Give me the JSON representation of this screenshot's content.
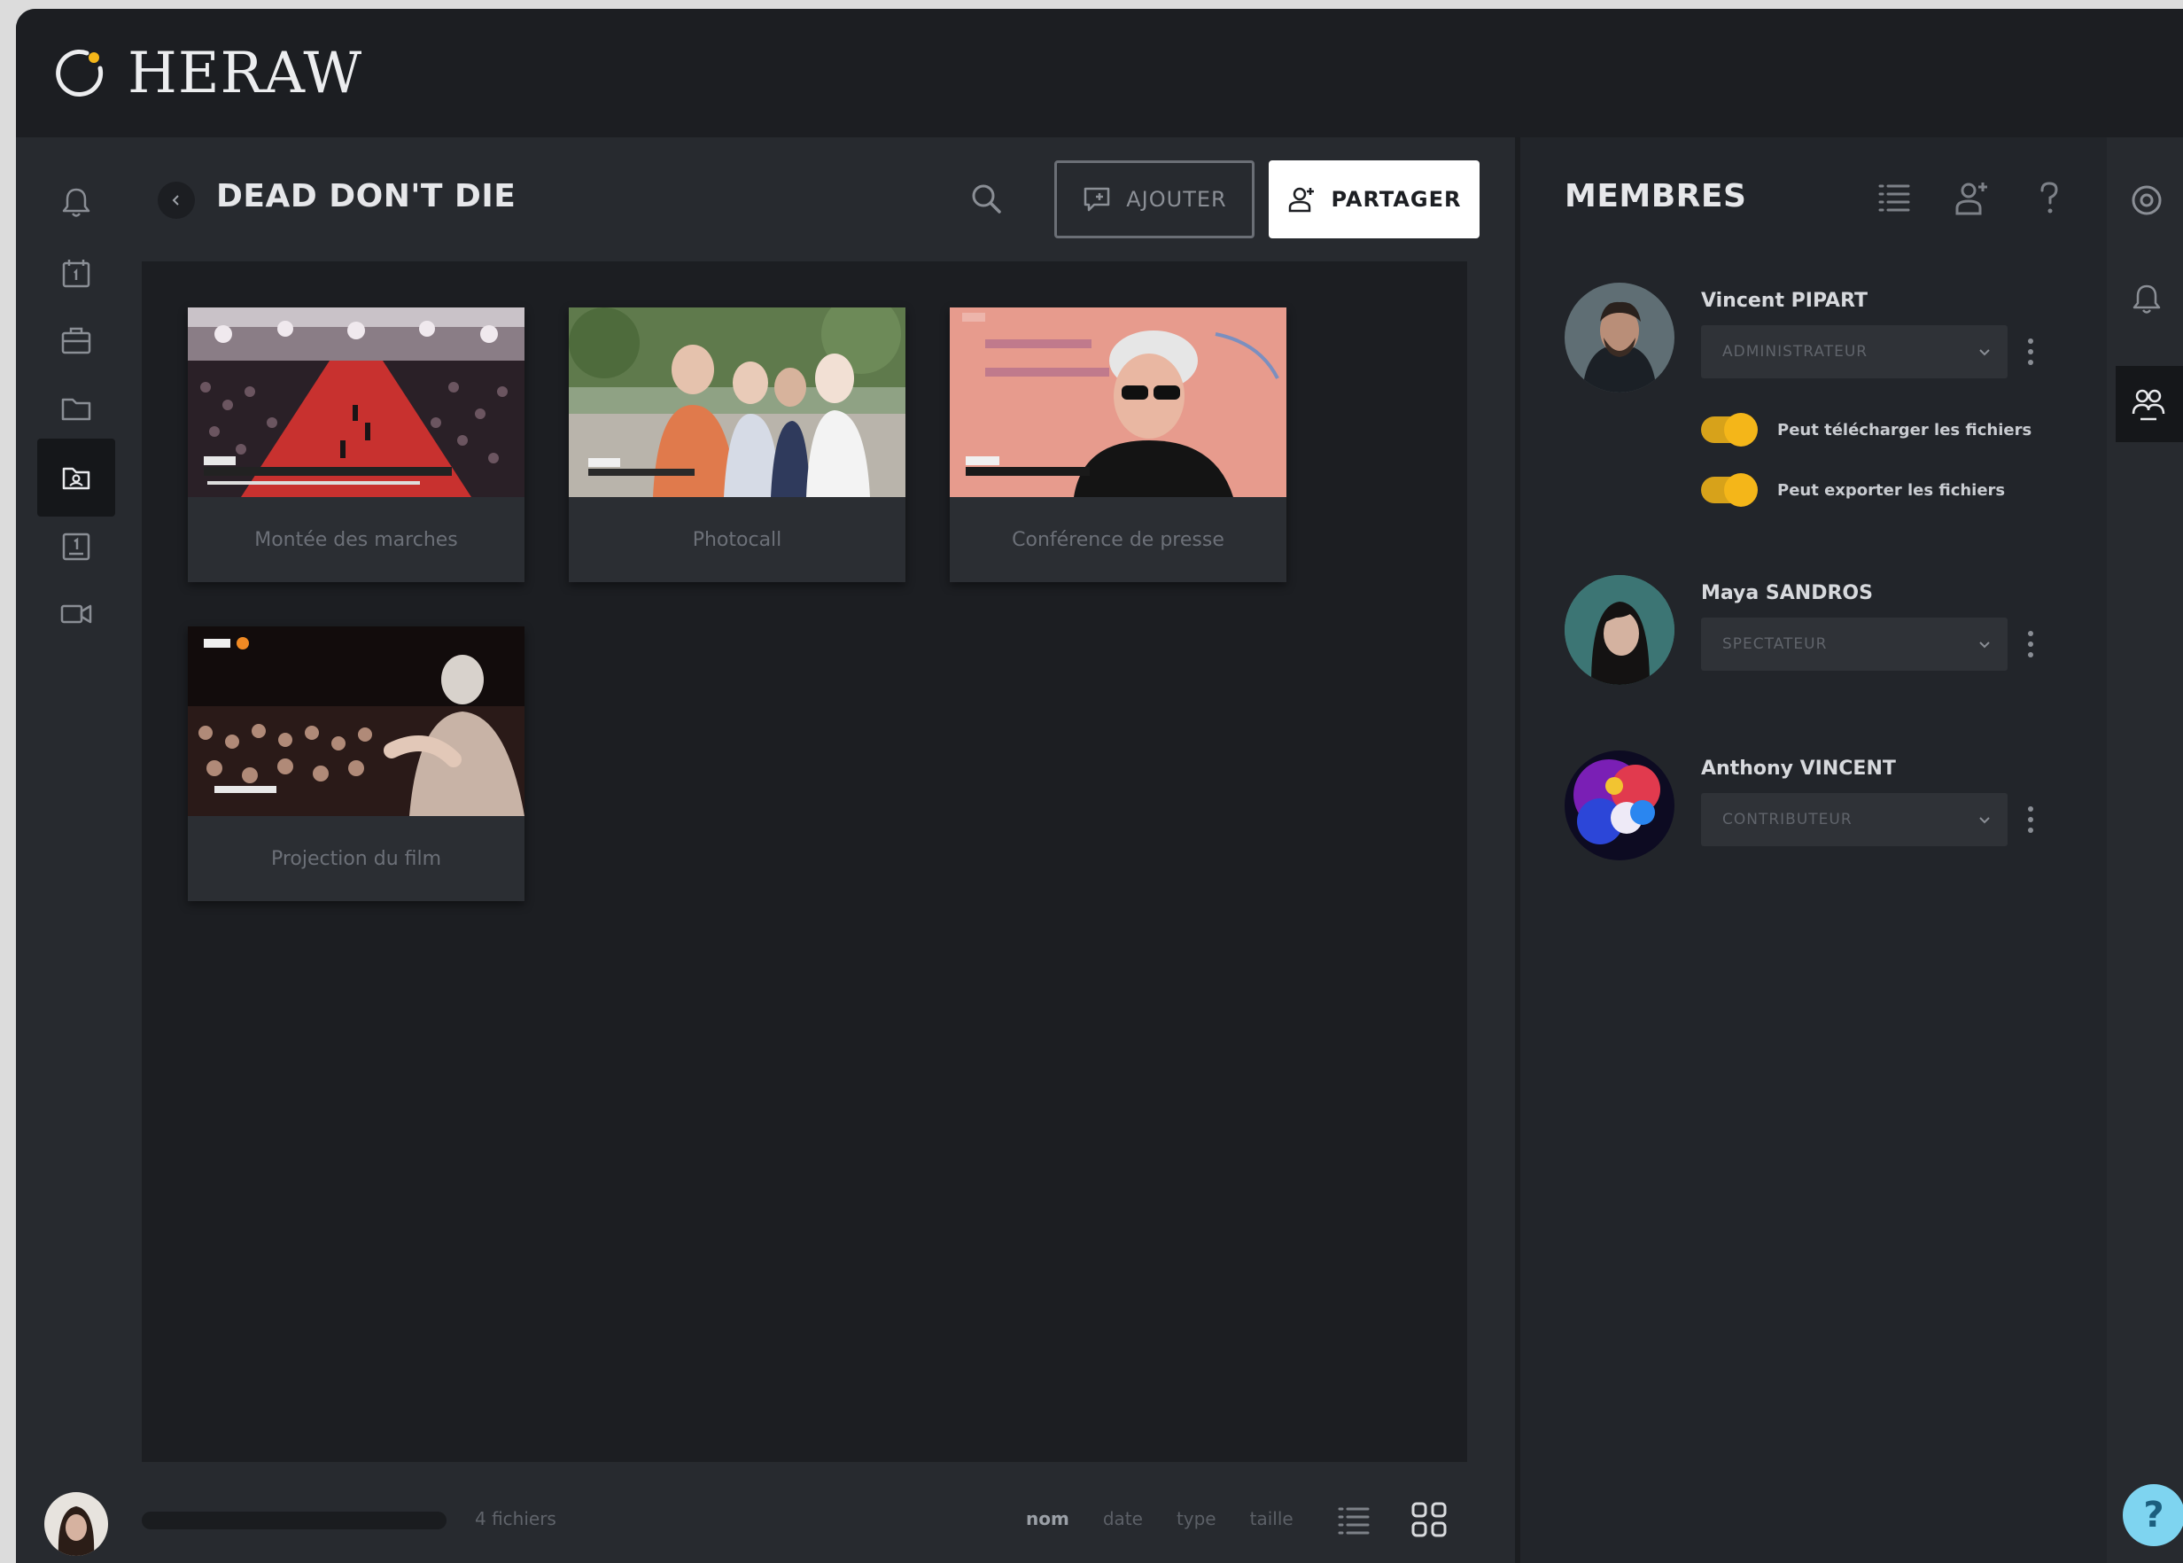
{
  "app": {
    "logo_text": "HERAW"
  },
  "header": {
    "project_title": "DEAD DON'T DIE",
    "add_label": "AJOUTER",
    "share_label": "PARTAGER"
  },
  "folders": [
    {
      "label": "Montée des marches"
    },
    {
      "label": "Photocall"
    },
    {
      "label": "Conférence de presse"
    },
    {
      "label": "Projection du film"
    }
  ],
  "footer": {
    "file_count": "4 fichiers",
    "sort_options": [
      "nom",
      "date",
      "type",
      "taille"
    ]
  },
  "members_panel": {
    "title": "MEMBRES",
    "members": [
      {
        "name": "Vincent PIPART",
        "role": "ADMINISTRATEUR",
        "permissions": [
          {
            "label": "Peut télécharger les fichiers"
          },
          {
            "label": "Peut exporter les fichiers"
          }
        ]
      },
      {
        "name": "Maya SANDROS",
        "role": "SPECTATEUR"
      },
      {
        "name": "Anthony VINCENT",
        "role": "CONTRIBUTEUR"
      }
    ]
  },
  "help_label": "?",
  "colors": {
    "accent": "#f4b619",
    "panel": "#22252a",
    "content_bg": "#1c1e22",
    "help_fab": "#7ed4f0"
  }
}
